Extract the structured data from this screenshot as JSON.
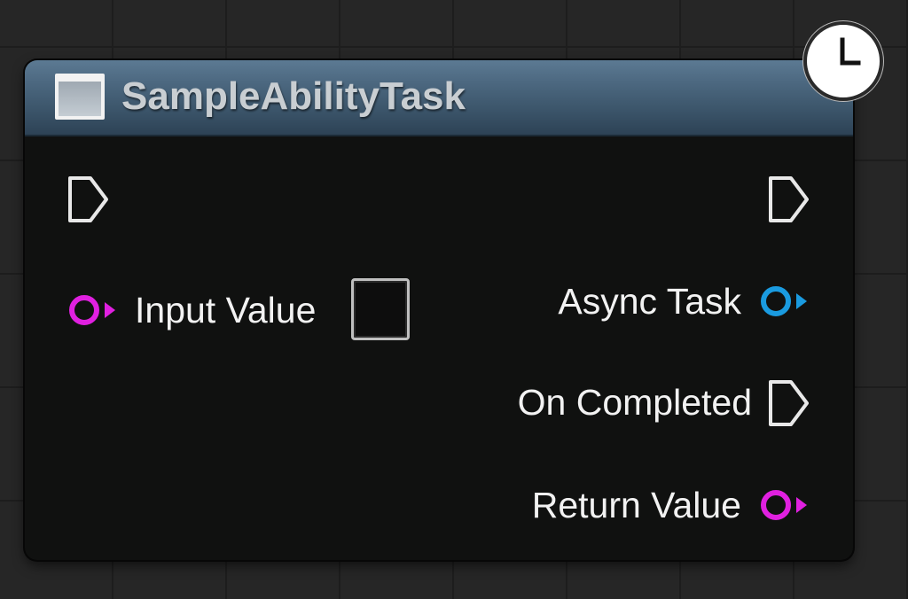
{
  "node": {
    "title": "SampleAbilityTask",
    "header_icon": "function-node-icon",
    "latent_icon": "clock-icon",
    "header_color": "#4c6880"
  },
  "inputs": {
    "exec_in": {
      "type": "exec",
      "icon": "exec-pin-icon"
    },
    "input_value": {
      "label": "Input Value",
      "color": "#e020e0",
      "default_value": "unchecked"
    }
  },
  "outputs": {
    "exec_out": {
      "type": "exec",
      "icon": "exec-pin-icon"
    },
    "async_task": {
      "label": "Async Task",
      "color": "#1a9be0"
    },
    "on_completed": {
      "label": "On Completed",
      "type": "exec"
    },
    "return_value": {
      "label": "Return Value",
      "color": "#e020e0"
    }
  }
}
